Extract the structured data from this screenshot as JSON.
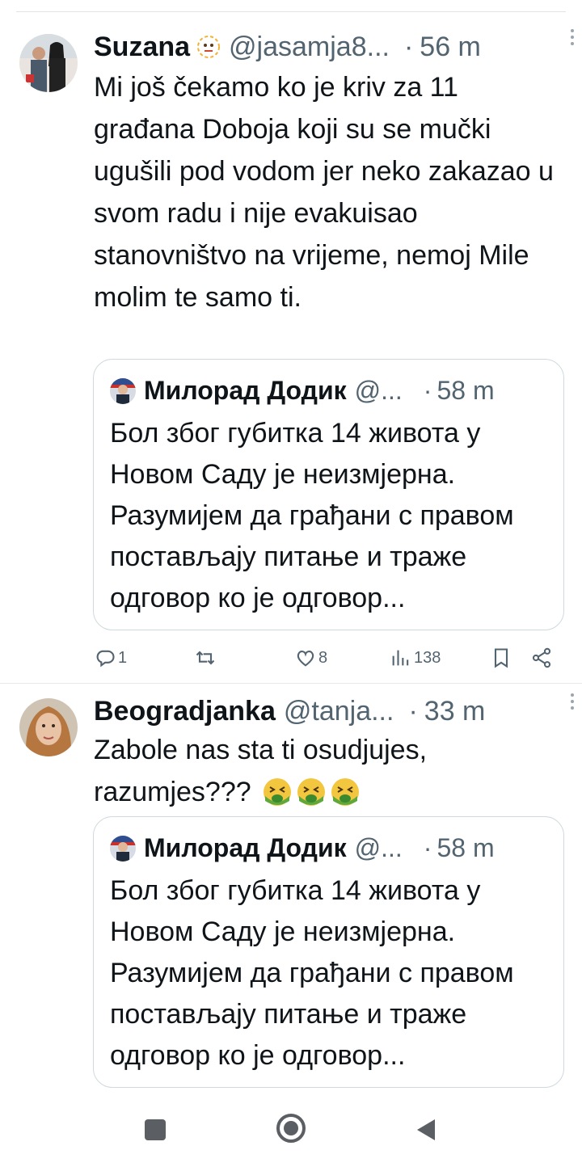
{
  "tweets": [
    {
      "name": "Suzana",
      "handle": "@jasamja8...",
      "time": "56 m",
      "text": "Mi još čekamo ko je kriv za 11 građana Doboja koji su se mučki ugušili pod vodom jer neko zakazao u svom radu i nije evakuisao stanovništvo na vrijeme, nemoj Mile molim te samo ti.",
      "name_emoji": "smiling-face-icon",
      "quote": {
        "name": "Милорад Додик",
        "handle": "@...",
        "time": "58 m",
        "text": "Бол због губитка 14 живота у Новом Саду је неизмјерна. Разумијем да грађани с правом постављају питање и траже одговор ко је одговор..."
      },
      "stats": {
        "replies": "1",
        "retweets": "",
        "likes": "8",
        "views": "138"
      }
    },
    {
      "name": "Beogradjanka",
      "handle": "@tanja...",
      "time": "33 m",
      "text": "Zabole nas sta ti osudjujes, razumjes???",
      "emojis": [
        "nauseated-face-icon",
        "nauseated-face-icon",
        "nauseated-face-icon"
      ],
      "quote": {
        "name": "Милорад Додик",
        "handle": "@...",
        "time": "58 m",
        "text": "Бол због губитка 14 живота у Новом Саду је неизмјерна. Разумијем да грађани с правом постављају питање и траже одговор ко је одговор..."
      }
    }
  ],
  "dot_sep": "·",
  "colors": {
    "text": "#0f1419",
    "secondary": "#536471",
    "border": "#cfd9de"
  },
  "nav": [
    "recents-square-icon",
    "home-circle-icon",
    "back-triangle-icon"
  ]
}
